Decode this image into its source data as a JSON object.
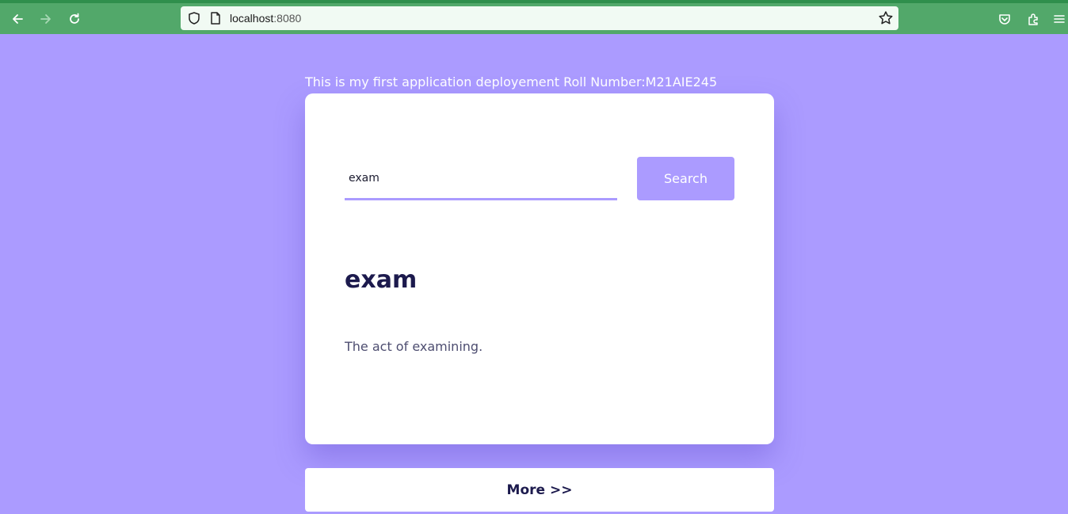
{
  "browser": {
    "url_host": "localhost",
    "url_port": ":8080",
    "icons": [
      "back-arrow-icon",
      "forward-arrow-icon",
      "reload-icon",
      "shield-icon",
      "page-icon",
      "bookmark-star-icon",
      "pocket-icon",
      "extensions-icon",
      "menu-icon"
    ]
  },
  "page": {
    "heading": "This is my first application deployement Roll Number:M21AIE245",
    "search": {
      "value": "exam",
      "button_label": "Search"
    },
    "result": {
      "word": "exam",
      "definition": "The act of examining."
    },
    "more_label": "More >>"
  },
  "colors": {
    "background": "#ab9bff",
    "accent": "#ab9bff",
    "title_text": "#1c1a4d",
    "chrome": "#52a86a"
  }
}
